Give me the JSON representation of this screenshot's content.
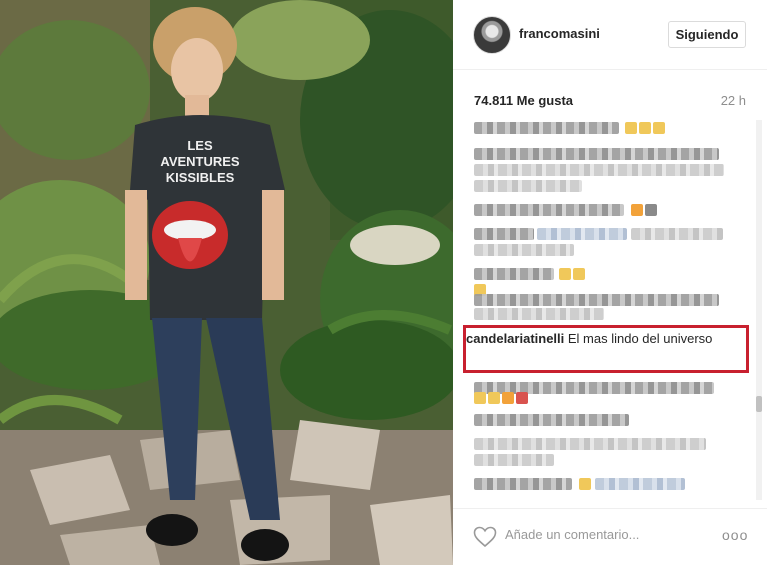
{
  "post": {
    "username": "francomasini",
    "follow_label": "Siguiendo",
    "likes": "74.811 Me gusta",
    "time_ago": "22 h",
    "highlighted_comment": {
      "author": "candelariatinelli",
      "text": "El mas lindo del universo"
    },
    "comment_placeholder": "Añade un comentario...",
    "more_label": "ooo",
    "shirt_text_line1": "LES",
    "shirt_text_line2": "AVENTURES",
    "shirt_text_line3": "KISSIBLES"
  },
  "icons": {
    "heart": "heart-icon",
    "more": "more-options-icon"
  },
  "colors": {
    "highlight": "#c8202f",
    "muted_text": "#8e8e8e"
  }
}
